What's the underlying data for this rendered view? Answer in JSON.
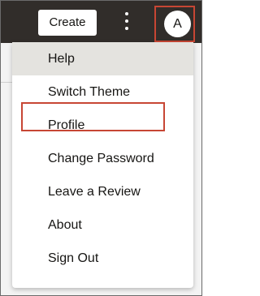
{
  "header": {
    "create_label": "Create",
    "avatar_initial": "A"
  },
  "menu": {
    "items": [
      {
        "label": "Help"
      },
      {
        "label": "Switch Theme"
      },
      {
        "label": "Profile"
      },
      {
        "label": "Change Password"
      },
      {
        "label": "Leave a Review"
      },
      {
        "label": "About"
      },
      {
        "label": "Sign Out"
      }
    ]
  },
  "colors": {
    "topbar": "#312d2a",
    "highlight_outline": "#c74634",
    "hover_row": "#e4e3df"
  }
}
